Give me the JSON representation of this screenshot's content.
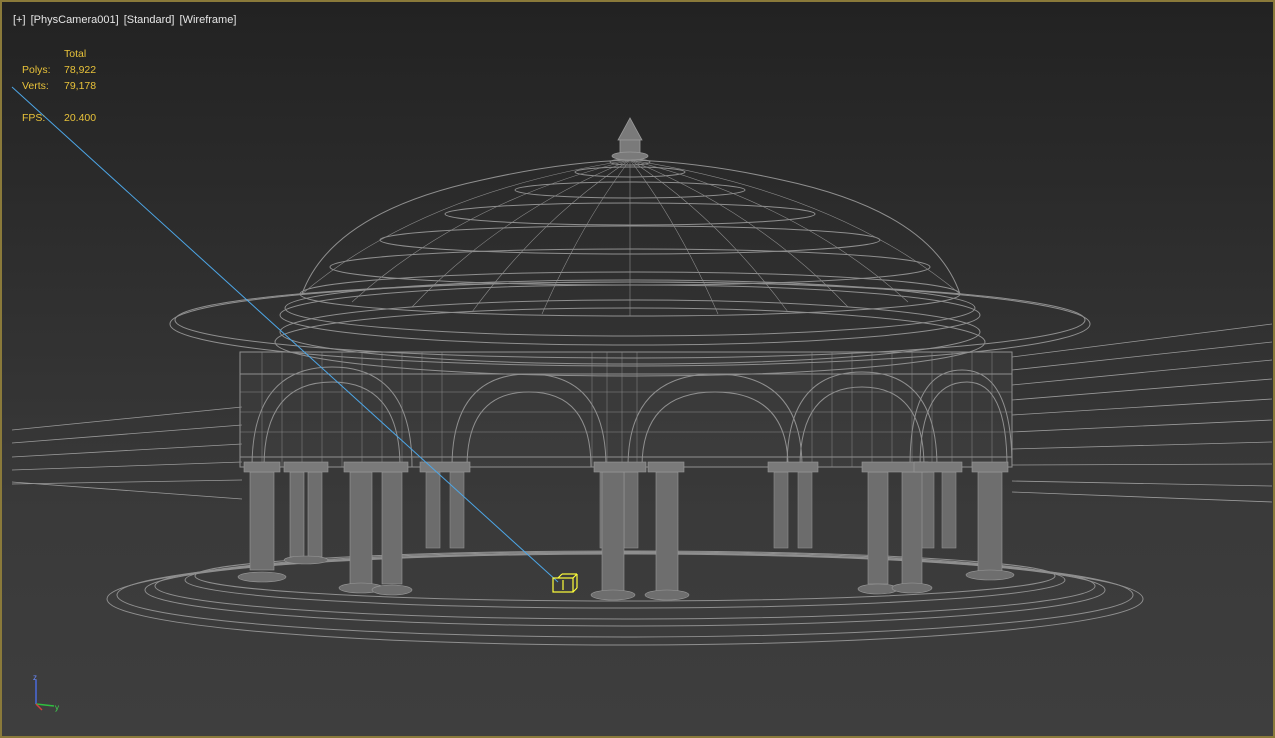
{
  "viewport": {
    "labels": {
      "plus": "[+]",
      "camera": "[PhysCamera001]",
      "shading": "[Standard]",
      "mode": "[Wireframe]"
    },
    "stats": {
      "header": "Total",
      "polys_label": "Polys:",
      "polys_value": "78,922",
      "verts_label": "Verts:",
      "verts_value": "79,178",
      "fps_label": "FPS:",
      "fps_value": "20.400"
    },
    "gizmo": {
      "z": "z",
      "y": "y",
      "x": "x"
    },
    "colors": {
      "wire": "#8f8f8f",
      "selected": "#ffff3a",
      "camera_line": "#4da6e6",
      "border": "#8a7a3a",
      "stats_text": "#e8c23a"
    }
  }
}
